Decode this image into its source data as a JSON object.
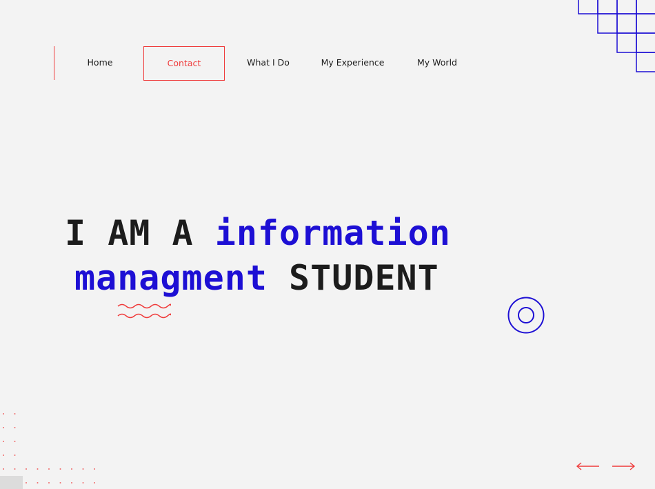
{
  "nav": {
    "items": [
      {
        "label": "Home",
        "active": false
      },
      {
        "label": "Contact",
        "active": true
      },
      {
        "label": "What I Do",
        "active": false
      },
      {
        "label": "My Experience",
        "active": false
      },
      {
        "label": "My World",
        "active": false
      }
    ]
  },
  "hero": {
    "line1_prefix": "I AM A ",
    "line1_highlight": "information",
    "line2_highlight": "managment",
    "line2_suffix": " STUDENT"
  },
  "colors": {
    "accent_red": "#ef3b3b",
    "accent_blue": "#1d0fd4",
    "text": "#1c1c1c",
    "background": "#f3f3f3"
  },
  "icons": {
    "grid": "grid-steps-icon",
    "wave": "wavy-lines-icon",
    "ring": "concentric-circle-icon",
    "prev": "arrow-left-icon",
    "next": "arrow-right-icon"
  }
}
